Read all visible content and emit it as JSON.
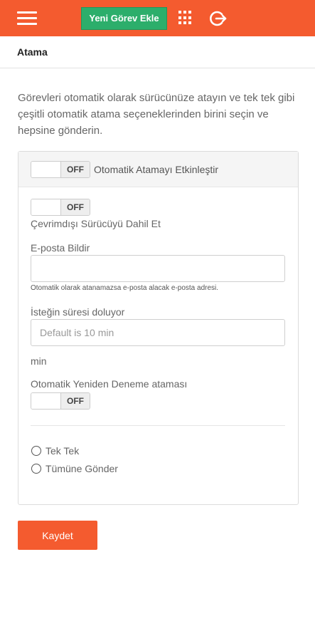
{
  "header": {
    "menu_icon": "hamburger-menu-icon",
    "add_task_label": "Yeni Görev Ekle",
    "apps_icon": "grid-apps-icon",
    "logout_icon": "logout-icon",
    "brand_color": "#f45b2f",
    "button_color": "#2cae6b"
  },
  "page": {
    "title": "Atama",
    "intro": "Görevleri otomatik olarak sürücünüze atayın ve tek tek gibi çeşitli otomatik atama seçeneklerinden birini seçin ve hepsine gönderin."
  },
  "panel": {
    "auto_assign": {
      "state": "OFF",
      "label": "Otomatik Atamayı Etkinleştir"
    },
    "offline_driver": {
      "state": "OFF",
      "label": "Çevrimdışı Sürücüyü Dahil Et"
    },
    "email": {
      "label": "E-posta Bildir",
      "value": "",
      "help": "Otomatik olarak atanamazsa e-posta alacak e-posta adresi."
    },
    "request_expiry": {
      "label": "İsteğin süresi doluyor",
      "placeholder": "Default is 10 min",
      "unit": "min"
    },
    "auto_retry": {
      "label": "Otomatik Yeniden Deneme ataması",
      "state": "OFF"
    },
    "options": [
      {
        "label": "Tek Tek",
        "selected": false
      },
      {
        "label": "Tümüne Gönder",
        "selected": false
      }
    ]
  },
  "actions": {
    "save_label": "Kaydet"
  }
}
